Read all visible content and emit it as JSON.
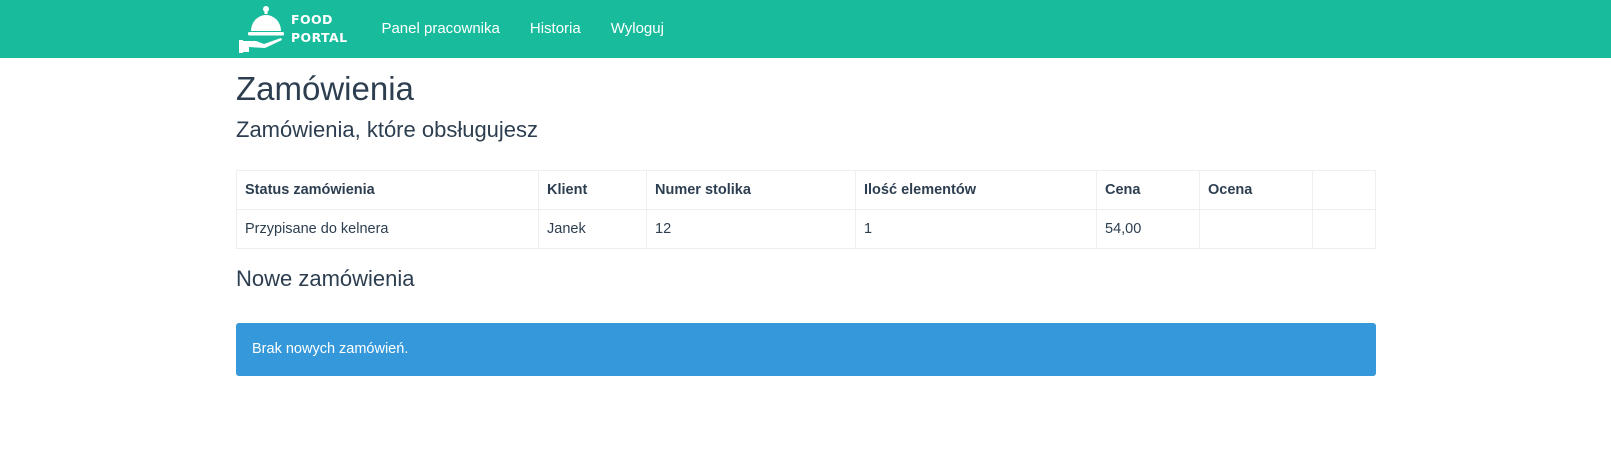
{
  "navbar": {
    "brand": {
      "line1": "FOOD",
      "line2": "PORTAL",
      "icon": "serving-cloche-icon"
    },
    "links": [
      {
        "label": "Panel pracownika"
      },
      {
        "label": "Historia"
      },
      {
        "label": "Wyloguj"
      }
    ]
  },
  "main": {
    "title": "Zamówienia",
    "handled": {
      "title": "Zamówienia, które obsługujesz",
      "columns": [
        "Status zamówienia",
        "Klient",
        "Numer stolika",
        "Ilość elementów",
        "Cena",
        "Ocena",
        ""
      ],
      "rows": [
        [
          "Przypisane do kelnera",
          "Janek",
          "12",
          "1",
          "54,00",
          "",
          ""
        ]
      ]
    },
    "new_orders": {
      "title": "Nowe zamówienia",
      "empty_message": "Brak nowych zamówień."
    }
  },
  "colors": {
    "navbar": "#18bc9c",
    "text": "#2c3e50",
    "alert": "#3498db",
    "table_border": "#ecf0f1"
  }
}
